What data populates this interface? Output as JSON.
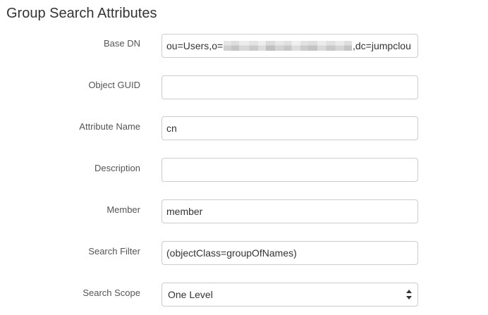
{
  "section": {
    "title": "Group Search Attributes"
  },
  "fields": {
    "base_dn": {
      "label": "Base DN",
      "value_prefix": "ou=Users,o=",
      "value_suffix": ",dc=jumpclou"
    },
    "object_guid": {
      "label": "Object GUID",
      "value": ""
    },
    "attribute_name": {
      "label": "Attribute Name",
      "value": "cn"
    },
    "description": {
      "label": "Description",
      "value": ""
    },
    "member": {
      "label": "Member",
      "value": "member"
    },
    "search_filter": {
      "label": "Search Filter",
      "value": "(objectClass=groupOfNames)"
    },
    "search_scope": {
      "label": "Search Scope",
      "selected": "One Level"
    }
  },
  "colors": {
    "label_text": "#555555",
    "input_border": "#cccccc",
    "title_text": "#333333"
  },
  "icons": {
    "select_arrows": "updown-chevron-icon"
  }
}
